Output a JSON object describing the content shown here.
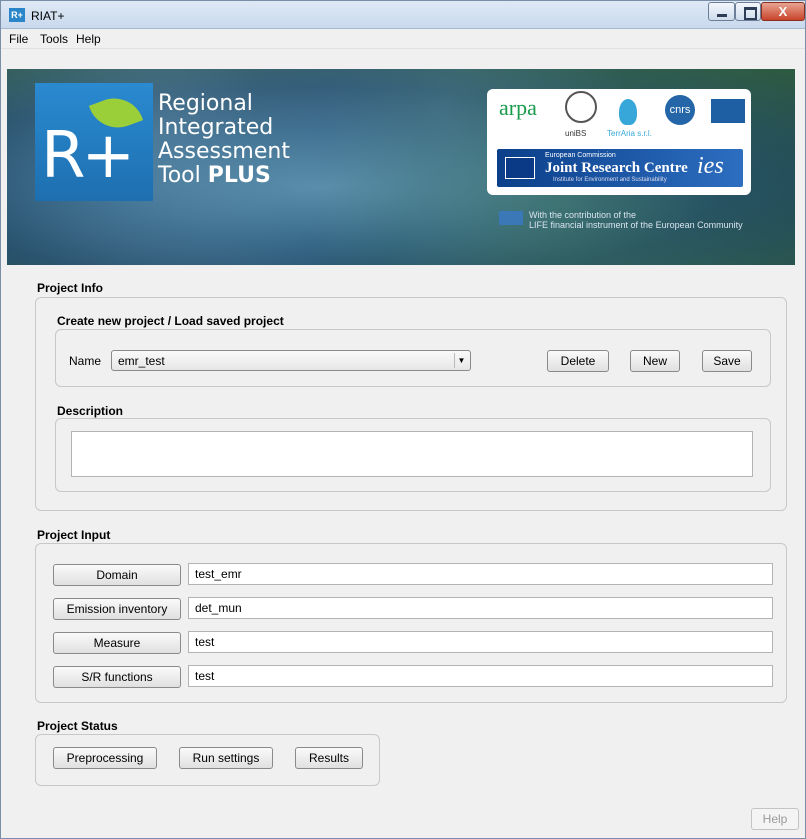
{
  "window": {
    "title": "RIAT+",
    "icon_label": "R+",
    "close_glyph": "X"
  },
  "menu": [
    "File",
    "Tools",
    "Help"
  ],
  "banner": {
    "title_lines": [
      "Regional",
      "Integrated",
      "Assessment",
      "Tool"
    ],
    "title_bold": "PLUS",
    "logo_text": "R+",
    "partners": [
      "arpa",
      "uniBS",
      "TerrAria s.r.l.",
      "cnrs"
    ],
    "jrc_small": "European Commission",
    "jrc_name": "Joint Research Centre",
    "jrc_sub": "Institute for Environment and Sustainability",
    "ies": "ies",
    "life_line1": "With the contribution of the",
    "life_line2": "LIFE financial instrument of the European Community"
  },
  "project_info": {
    "title": "Project Info",
    "subtitle": "Create new project / Load saved project",
    "name_label": "Name",
    "name_value": "emr_test",
    "delete_label": "Delete",
    "new_label": "New",
    "save_label": "Save",
    "description_title": "Description",
    "description_value": ""
  },
  "project_input": {
    "title": "Project Input",
    "rows": [
      {
        "button": "Domain",
        "value": "test_emr"
      },
      {
        "button": "Emission inventory",
        "value": "det_mun"
      },
      {
        "button": "Measure",
        "value": "test"
      },
      {
        "button": "S/R functions",
        "value": "test"
      }
    ]
  },
  "project_status": {
    "title": "Project Status",
    "preprocessing_label": "Preprocessing",
    "run_settings_label": "Run settings",
    "results_label": "Results"
  },
  "footer": {
    "help_label": "Help"
  }
}
